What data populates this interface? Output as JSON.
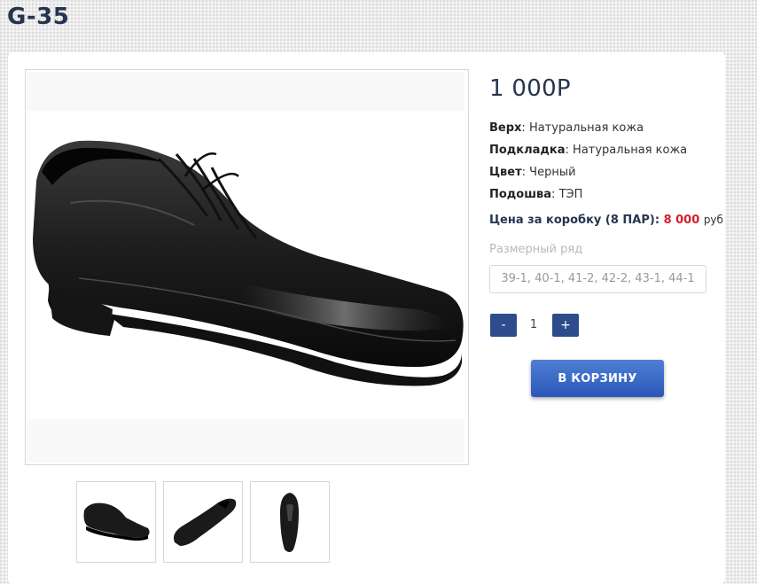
{
  "product": {
    "title": "G-35",
    "price": "1 000Р",
    "specs": [
      {
        "label": "Верх",
        "value": "Натуральная кожа"
      },
      {
        "label": "Подкладка",
        "value": "Натуральная кожа"
      },
      {
        "label": "Цвет",
        "value": "Черный"
      },
      {
        "label": "Подошва",
        "value": "ТЭП"
      }
    ],
    "box_price": {
      "label": "Цена за коробку (8 ПАР):",
      "value": "8 000",
      "currency": "руб"
    },
    "size": {
      "label": "Размерный ряд",
      "selected": "39-1, 40-1, 41-2, 42-2, 43-1, 44-1"
    },
    "quantity": {
      "minus": "-",
      "value": "1",
      "plus": "+"
    },
    "cart_button": "В КОРЗИНУ",
    "main_image_icon": "black-leather-shoe",
    "thumbnails": [
      "shoe-side-view",
      "shoe-angle-view",
      "shoe-top-view"
    ]
  }
}
